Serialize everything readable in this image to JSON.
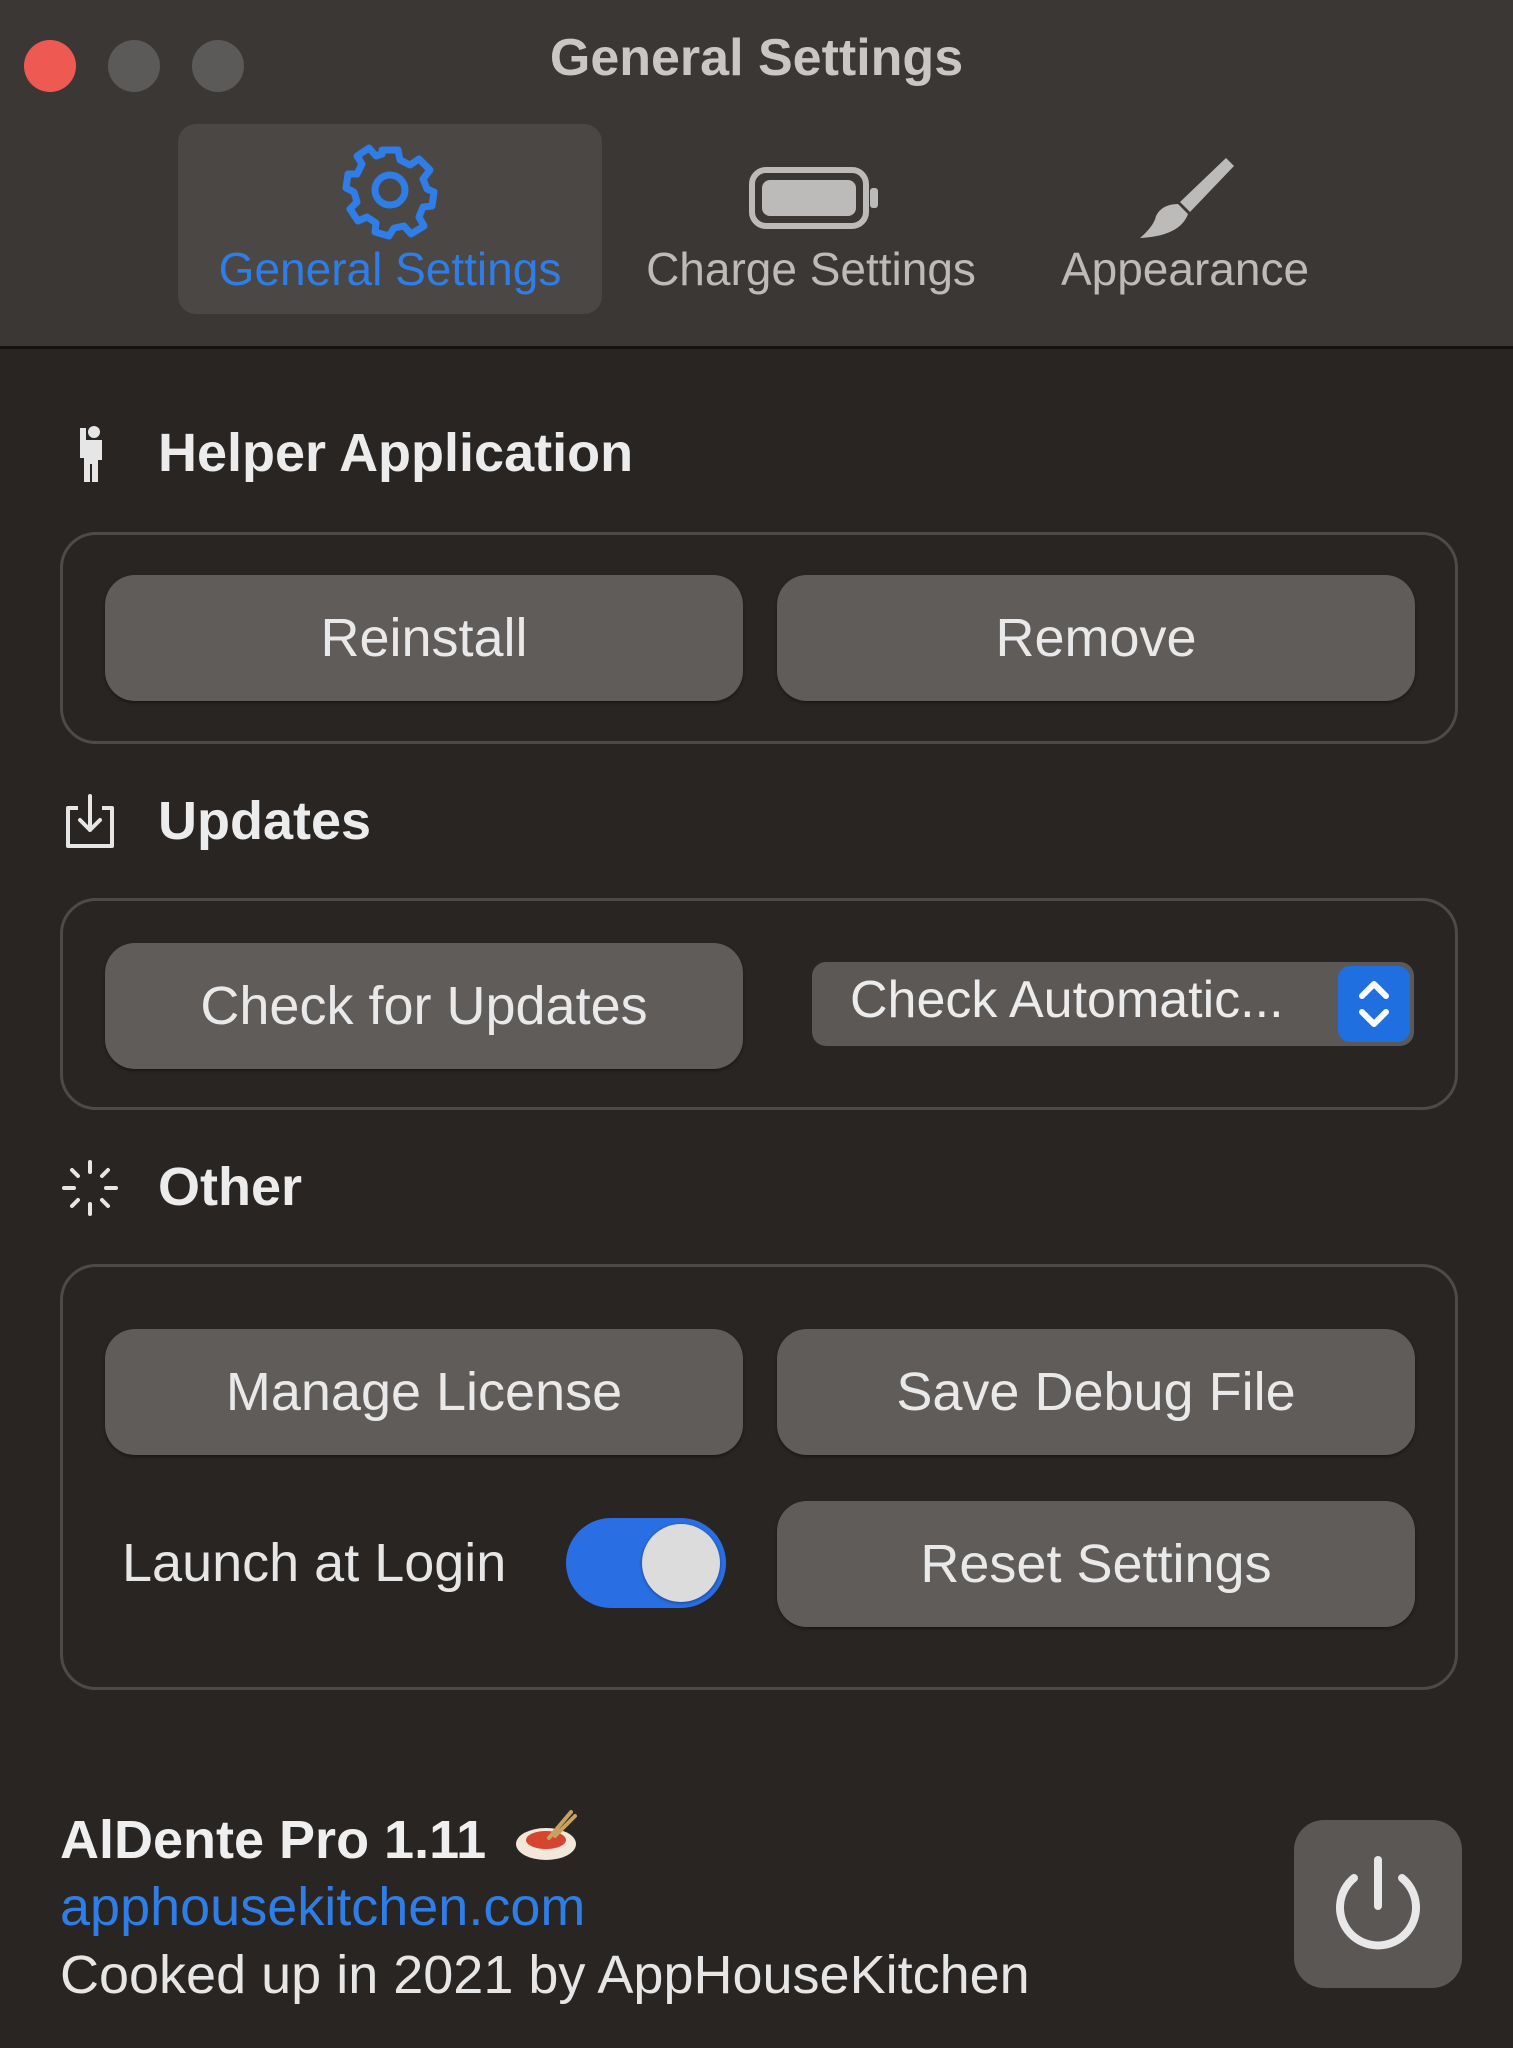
{
  "window": {
    "title": "General Settings"
  },
  "tabs": [
    {
      "label": "General Settings",
      "icon": "gear-icon",
      "active": true
    },
    {
      "label": "Charge Settings",
      "icon": "battery-icon",
      "active": false
    },
    {
      "label": "Appearance",
      "icon": "paintbrush-icon",
      "active": false
    }
  ],
  "sections": {
    "helper": {
      "title": "Helper Application",
      "icon": "person-icon",
      "reinstall_label": "Reinstall",
      "remove_label": "Remove"
    },
    "updates": {
      "title": "Updates",
      "icon": "download-icon",
      "check_label": "Check for Updates",
      "auto_select_value": "Check Automatic..."
    },
    "other": {
      "title": "Other",
      "icon": "spinner-icon",
      "manage_license_label": "Manage License",
      "save_debug_label": "Save Debug File",
      "launch_at_login_label": "Launch at Login",
      "launch_at_login_on": true,
      "reset_label": "Reset Settings"
    }
  },
  "footer": {
    "app_name": "AlDente Pro 1.11",
    "link": "apphousekitchen.com",
    "credit": "Cooked up in 2021 by AppHouseKitchen"
  },
  "colors": {
    "accent": "#2f7de6",
    "close_button": "#ee5a52",
    "background": "#292522"
  }
}
